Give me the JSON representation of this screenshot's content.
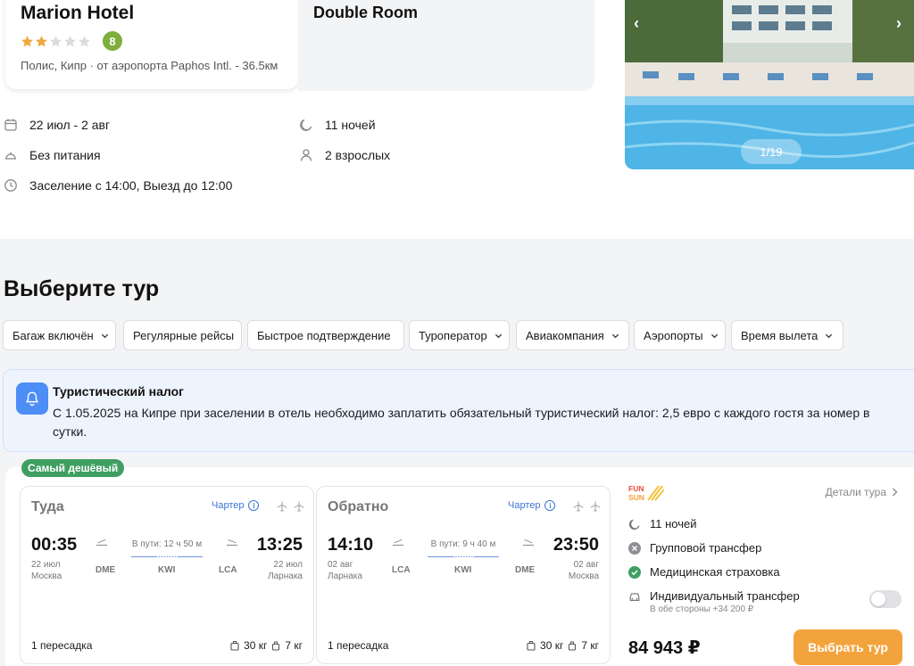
{
  "hotel": {
    "name": "Marion Hotel",
    "stars_filled": 2,
    "stars_total": 5,
    "rating": "8",
    "location": "Полис, Кипр · от аэропорта Paphos Intl. - 36.5км"
  },
  "room": {
    "name": "Double Room"
  },
  "trip_details": {
    "dates": "22 июл - 2 авг",
    "nights": "11 ночей",
    "meals": "Без питания",
    "guests": "2 взрослых",
    "checkin": "Заселение с 14:00, Выезд до 12:00"
  },
  "gallery": {
    "counter": "1/19",
    "prev_label": "‹",
    "next_label": "›"
  },
  "tours": {
    "title": "Выберите тур",
    "filters": [
      {
        "label": "Багаж включён",
        "has_dropdown": true
      },
      {
        "label": "Регулярные рейсы",
        "has_dropdown": false
      },
      {
        "label": "Быстрое подтверждение",
        "has_dropdown": false
      },
      {
        "label": "Туроператор",
        "has_dropdown": true
      },
      {
        "label": "Авиакомпания",
        "has_dropdown": true
      },
      {
        "label": "Аэропорты",
        "has_dropdown": true
      },
      {
        "label": "Время вылета",
        "has_dropdown": true
      }
    ]
  },
  "notice": {
    "title": "Туристический налог",
    "text": "С 1.05.2025 на Кипре при заселении в отель необходимо заплатить обязательный туристический налог: 2,5 евро с каждого гостя за номер в сутки."
  },
  "offer": {
    "badge": "Самый дешёвый",
    "outbound": {
      "direction": "Туда",
      "charter": "Чартер",
      "dep_time": "00:35",
      "arr_time": "13:25",
      "dep_date": "22 июл",
      "dep_city": "Москва",
      "arr_date": "22 июл",
      "arr_city": "Ларнака",
      "duration": "В пути: 12 ч 50 м",
      "codes": [
        "DME",
        "KWI",
        "LCA"
      ],
      "transfers": "1 пересадка",
      "baggage": "30 кг",
      "hand_luggage": "7 кг"
    },
    "inbound": {
      "direction": "Обратно",
      "charter": "Чартер",
      "dep_time": "14:10",
      "arr_time": "23:50",
      "dep_date": "02 авг",
      "dep_city": "Ларнака",
      "arr_date": "02 авг",
      "arr_city": "Москва",
      "duration": "В пути: 9 ч 40 м",
      "codes": [
        "LCA",
        "KWI",
        "DME"
      ],
      "transfers": "1 пересадка",
      "baggage": "30 кг",
      "hand_luggage": "7 кг"
    },
    "operator_logo_text": [
      "FUN",
      "SUN"
    ],
    "details_link": "Детали тура",
    "nights": "11 ночей",
    "group_transfer": "Групповой трансфер",
    "insurance": "Медицинская страховка",
    "individual_transfer": "Индивидуальный трансфер",
    "individual_transfer_sub": "В обе стороны +34 200 ₽",
    "price": "84 943 ₽",
    "select_button": "Выбрать тур"
  },
  "colors": {
    "accent_orange": "#f3a33c",
    "rating_green": "#7fae3b",
    "badge_green": "#3f9f61",
    "link_blue": "#3b74d6",
    "star_gold": "#f0a93b"
  }
}
